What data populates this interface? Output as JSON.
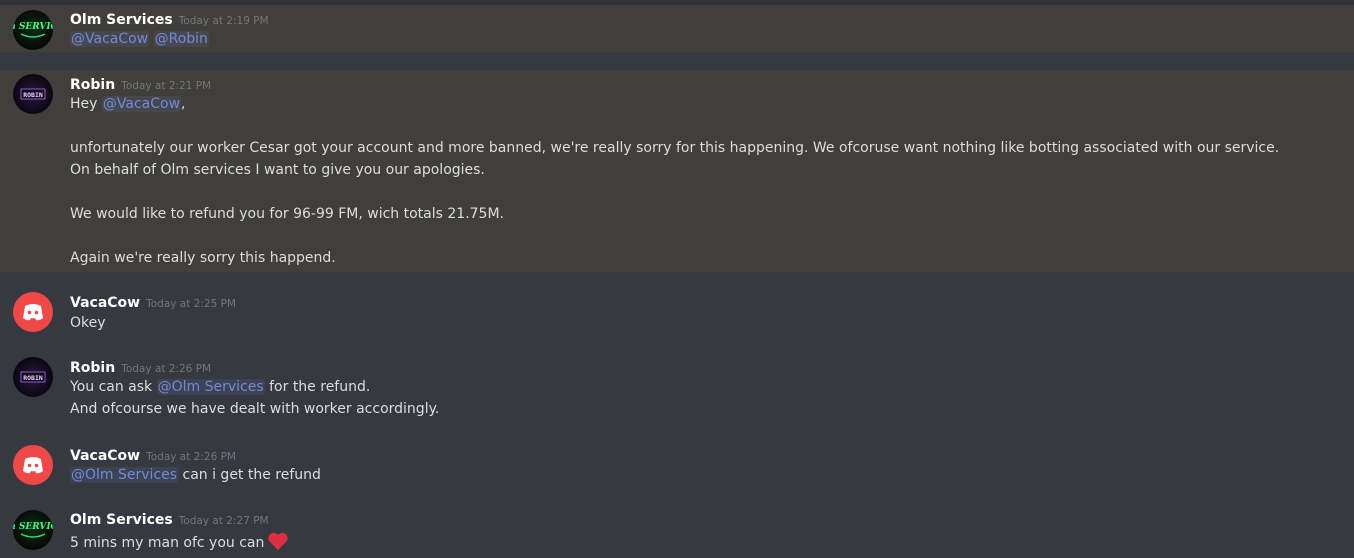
{
  "messages": [
    {
      "author": "Olm Services",
      "timestamp": "Today at 2:19 PM",
      "avatar": "olm-services-avatar",
      "avatar_text": "Olm SERVICES",
      "highlighted": true,
      "lines": [
        {
          "mentions": [
            "@VacaCow",
            "@Robin"
          ]
        }
      ]
    },
    {
      "author": "Robin",
      "timestamp": "Today at 2:21 PM",
      "avatar": "robin-avatar",
      "avatar_text": "ROBIN",
      "highlighted": true,
      "lines": [
        {
          "pre": "Hey ",
          "mention": "@VacaCow",
          "post": ","
        },
        {
          "text": "unfortunately our worker Cesar got your account and more banned, we're really sorry for this happening. We ofcoruse want nothing like botting associated with our service."
        },
        {
          "text": "On behalf of Olm services I want to give you our apologies."
        },
        {
          "text": "We would like to refund you for 96-99 FM, wich totals 21.75M."
        },
        {
          "text": "Again we're really sorry this happend."
        }
      ]
    },
    {
      "author": "VacaCow",
      "timestamp": "Today at 2:25 PM",
      "avatar": "discord-default-avatar",
      "highlighted": false,
      "lines": [
        {
          "text": "Okey"
        }
      ]
    },
    {
      "author": "Robin",
      "timestamp": "Today at 2:26 PM",
      "avatar": "robin-avatar",
      "avatar_text": "ROBIN",
      "highlighted": false,
      "lines": [
        {
          "pre": "You can ask ",
          "mention": "@Olm Services",
          "post": " for the refund."
        },
        {
          "text": "And ofcourse we have dealt with worker accordingly."
        }
      ]
    },
    {
      "author": "VacaCow",
      "timestamp": "Today at 2:26 PM",
      "avatar": "discord-default-avatar",
      "highlighted": false,
      "lines": [
        {
          "pre": "",
          "mention": "@Olm Services",
          "post": " can i get the refund"
        }
      ]
    },
    {
      "author": "Olm Services",
      "timestamp": "Today at 2:27 PM",
      "avatar": "olm-services-avatar",
      "avatar_text": "Olm SERVICES",
      "highlighted": false,
      "lines": [
        {
          "text": "5 mins my man ofc you can",
          "emoji": "heart-icon"
        }
      ]
    }
  ],
  "colors": {
    "background": "#36393f",
    "highlight": "#403f3b",
    "mention": "#7289da",
    "author": "#ffffff",
    "timestamp": "#72767d",
    "discord_avatar": "#f04747",
    "heart": "#dd2e44"
  }
}
